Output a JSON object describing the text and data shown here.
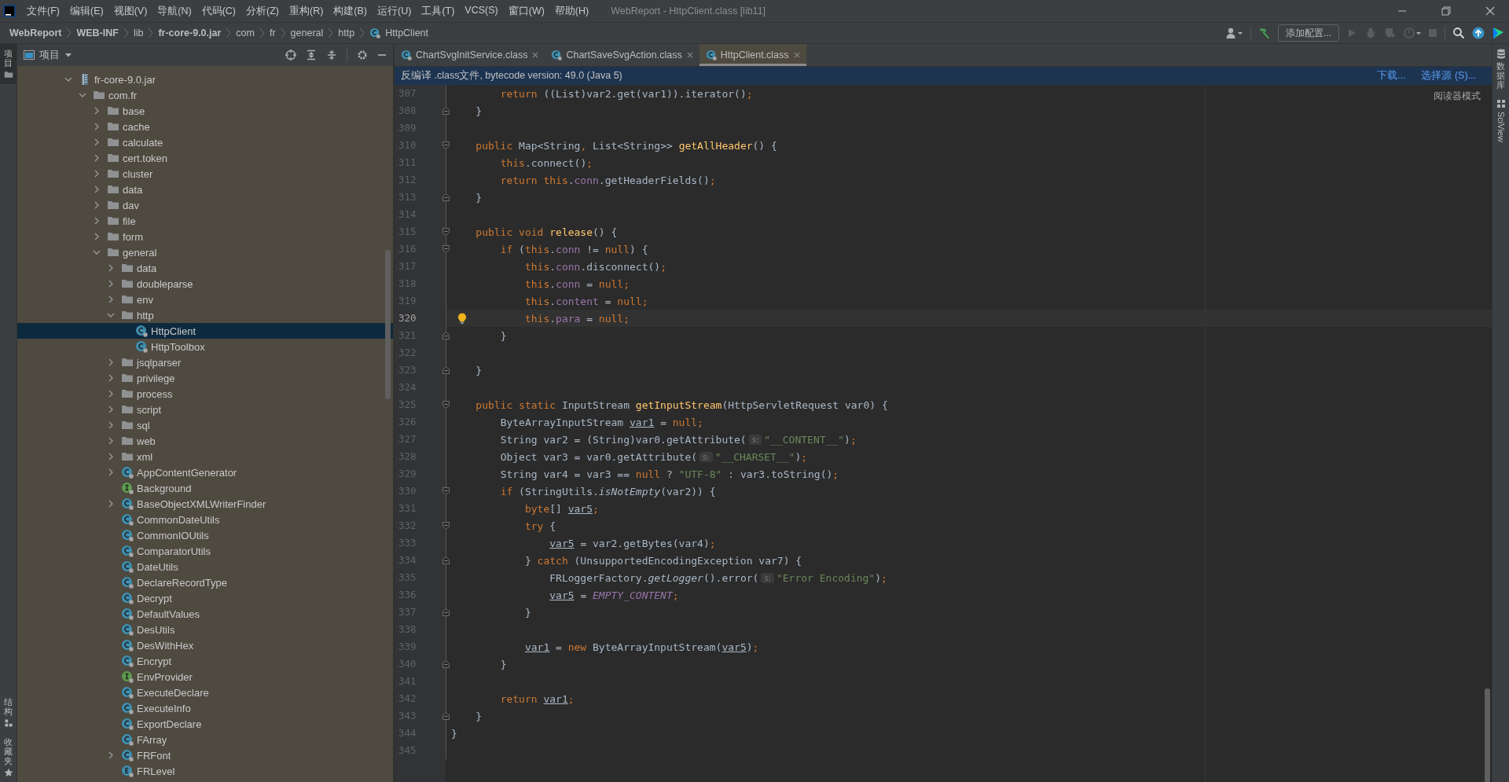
{
  "window": {
    "title": "WebReport - HttpClient.class [lib11]"
  },
  "menu": [
    "文件(F)",
    "编辑(E)",
    "视图(V)",
    "导航(N)",
    "代码(C)",
    "分析(Z)",
    "重构(R)",
    "构建(B)",
    "运行(U)",
    "工具(T)",
    "VCS(S)",
    "窗口(W)",
    "帮助(H)"
  ],
  "breadcrumbs": [
    {
      "label": "WebReport",
      "bold": true,
      "kind": "path"
    },
    {
      "label": "WEB-INF",
      "bold": true,
      "kind": "path"
    },
    {
      "label": "lib",
      "bold": false,
      "kind": "path"
    },
    {
      "label": "fr-core-9.0.jar",
      "bold": true,
      "kind": "path"
    },
    {
      "label": "com",
      "bold": false,
      "kind": "path"
    },
    {
      "label": "fr",
      "bold": false,
      "kind": "path"
    },
    {
      "label": "general",
      "bold": false,
      "kind": "path"
    },
    {
      "label": "http",
      "bold": false,
      "kind": "path"
    },
    {
      "label": "HttpClient",
      "bold": false,
      "kind": "class"
    }
  ],
  "toolbar": {
    "run_config": "添加配置..."
  },
  "left_stripe": {
    "top": [
      {
        "label": "项目",
        "selected": true
      }
    ],
    "bottom": [
      {
        "label": "结构",
        "selected": false
      },
      {
        "label": "收藏夹",
        "selected": false
      }
    ]
  },
  "project": {
    "title": "项目",
    "tree": [
      {
        "label": "fr-core-9.0.jar",
        "kind": "jar",
        "expanded": true,
        "selected": false,
        "children": [
          {
            "label": "com.fr",
            "kind": "folder",
            "expanded": true,
            "selected": false,
            "children": [
              {
                "label": "base",
                "kind": "folder",
                "expanded": false,
                "selected": false
              },
              {
                "label": "cache",
                "kind": "folder",
                "expanded": false,
                "selected": false
              },
              {
                "label": "calculate",
                "kind": "folder",
                "expanded": false,
                "selected": false
              },
              {
                "label": "cert.token",
                "kind": "folder",
                "expanded": false,
                "selected": false
              },
              {
                "label": "cluster",
                "kind": "folder",
                "expanded": false,
                "selected": false
              },
              {
                "label": "data",
                "kind": "folder",
                "expanded": false,
                "selected": false
              },
              {
                "label": "dav",
                "kind": "folder",
                "expanded": false,
                "selected": false
              },
              {
                "label": "file",
                "kind": "folder",
                "expanded": false,
                "selected": false
              },
              {
                "label": "form",
                "kind": "folder",
                "expanded": false,
                "selected": false
              },
              {
                "label": "general",
                "kind": "folder",
                "expanded": true,
                "selected": false,
                "children": [
                  {
                    "label": "data",
                    "kind": "folder",
                    "expanded": false,
                    "selected": false
                  },
                  {
                    "label": "doubleparse",
                    "kind": "folder",
                    "expanded": false,
                    "selected": false
                  },
                  {
                    "label": "env",
                    "kind": "folder",
                    "expanded": false,
                    "selected": false
                  },
                  {
                    "label": "http",
                    "kind": "folder",
                    "expanded": true,
                    "selected": false,
                    "children": [
                      {
                        "label": "HttpClient",
                        "kind": "class",
                        "selected": true
                      },
                      {
                        "label": "HttpToolbox",
                        "kind": "class",
                        "selected": false
                      }
                    ]
                  },
                  {
                    "label": "jsqlparser",
                    "kind": "folder",
                    "expanded": false,
                    "selected": false
                  },
                  {
                    "label": "privilege",
                    "kind": "folder",
                    "expanded": false,
                    "selected": false
                  },
                  {
                    "label": "process",
                    "kind": "folder",
                    "expanded": false,
                    "selected": false
                  },
                  {
                    "label": "script",
                    "kind": "folder",
                    "expanded": false,
                    "selected": false
                  },
                  {
                    "label": "sql",
                    "kind": "folder",
                    "expanded": false,
                    "selected": false
                  },
                  {
                    "label": "web",
                    "kind": "folder",
                    "expanded": false,
                    "selected": false
                  },
                  {
                    "label": "xml",
                    "kind": "folder",
                    "expanded": false,
                    "selected": false
                  },
                  {
                    "label": "AppContentGenerator",
                    "kind": "class",
                    "expanded": false,
                    "selected": false
                  },
                  {
                    "label": "Background",
                    "kind": "interface",
                    "selected": false
                  },
                  {
                    "label": "BaseObjectXMLWriterFinder",
                    "kind": "class",
                    "expanded": false,
                    "selected": false
                  },
                  {
                    "label": "CommonDateUtils",
                    "kind": "class",
                    "selected": false
                  },
                  {
                    "label": "CommonIOUtils",
                    "kind": "class",
                    "selected": false
                  },
                  {
                    "label": "ComparatorUtils",
                    "kind": "class",
                    "selected": false
                  },
                  {
                    "label": "DateUtils",
                    "kind": "class",
                    "selected": false
                  },
                  {
                    "label": "DeclareRecordType",
                    "kind": "class",
                    "selected": false
                  },
                  {
                    "label": "Decrypt",
                    "kind": "class",
                    "selected": false
                  },
                  {
                    "label": "DefaultValues",
                    "kind": "class",
                    "selected": false
                  },
                  {
                    "label": "DesUtils",
                    "kind": "class",
                    "selected": false
                  },
                  {
                    "label": "DesWithHex",
                    "kind": "class",
                    "selected": false
                  },
                  {
                    "label": "Encrypt",
                    "kind": "class",
                    "selected": false
                  },
                  {
                    "label": "EnvProvider",
                    "kind": "interface",
                    "selected": false
                  },
                  {
                    "label": "ExecuteDeclare",
                    "kind": "class",
                    "selected": false
                  },
                  {
                    "label": "ExecuteInfo",
                    "kind": "class",
                    "selected": false
                  },
                  {
                    "label": "ExportDeclare",
                    "kind": "class",
                    "selected": false
                  },
                  {
                    "label": "FArray",
                    "kind": "class",
                    "selected": false
                  },
                  {
                    "label": "FRFont",
                    "kind": "class",
                    "expanded": false,
                    "selected": false
                  },
                  {
                    "label": "FRLevel",
                    "kind": "enum",
                    "selected": false
                  }
                ]
              }
            ]
          }
        ]
      }
    ]
  },
  "editor": {
    "tabs": [
      {
        "label": "ChartSvgInitService.class",
        "selected": false
      },
      {
        "label": "ChartSaveSvgAction.class",
        "selected": false
      },
      {
        "label": "HttpClient.class",
        "selected": true
      }
    ],
    "banner": {
      "text": "反编译 .class文件, bytecode version: 49.0 (Java 5)",
      "links": [
        "下载...",
        "选择源 (S)..."
      ]
    },
    "reader_mode": "阅读器模式",
    "lines": [
      {
        "number": "307",
        "kind": "plain",
        "current": false,
        "tokens": [
          {
            "text": "        return",
            "kind": "keyword"
          },
          {
            "text": " ((List)var2.get(var1)).iterator()",
            "kind": "plain"
          },
          {
            "text": ";",
            "kind": "keyword"
          }
        ]
      },
      {
        "number": "308",
        "kind": "fold-end",
        "current": false,
        "tokens": [
          {
            "text": "    }",
            "kind": "plain"
          }
        ]
      },
      {
        "number": "309",
        "kind": "plain",
        "current": false
      },
      {
        "number": "310",
        "kind": "fold-start",
        "current": false,
        "tokens": [
          {
            "text": "    public",
            "kind": "keyword"
          },
          {
            "text": " Map<String",
            "kind": "plain"
          },
          {
            "text": ",",
            "kind": "keyword"
          },
          {
            "text": " List<String>> ",
            "kind": "plain"
          },
          {
            "text": "getAllHeader",
            "kind": "method"
          },
          {
            "text": "() {",
            "kind": "plain"
          }
        ]
      },
      {
        "number": "311",
        "kind": "plain",
        "current": false,
        "tokens": [
          {
            "text": "        this",
            "kind": "keyword"
          },
          {
            "text": ".connect()",
            "kind": "plain"
          },
          {
            "text": ";",
            "kind": "keyword"
          }
        ]
      },
      {
        "number": "312",
        "kind": "plain",
        "current": false,
        "tokens": [
          {
            "text": "        return this",
            "kind": "keyword"
          },
          {
            "text": ".",
            "kind": "plain"
          },
          {
            "text": "conn",
            "kind": "field"
          },
          {
            "text": ".getHeaderFields()",
            "kind": "plain"
          },
          {
            "text": ";",
            "kind": "keyword"
          }
        ]
      },
      {
        "number": "313",
        "kind": "fold-end",
        "current": false,
        "tokens": [
          {
            "text": "    }",
            "kind": "plain"
          }
        ]
      },
      {
        "number": "314",
        "kind": "plain",
        "current": false
      },
      {
        "number": "315",
        "kind": "fold-start",
        "current": false,
        "tokens": [
          {
            "text": "    public void ",
            "kind": "keyword"
          },
          {
            "text": "release",
            "kind": "method"
          },
          {
            "text": "() {",
            "kind": "plain"
          }
        ]
      },
      {
        "number": "316",
        "kind": "fold-start",
        "current": false,
        "tokens": [
          {
            "text": "        if ",
            "kind": "keyword"
          },
          {
            "text": "(",
            "kind": "plain"
          },
          {
            "text": "this",
            "kind": "keyword"
          },
          {
            "text": ".",
            "kind": "plain"
          },
          {
            "text": "conn",
            "kind": "field"
          },
          {
            "text": " != ",
            "kind": "plain"
          },
          {
            "text": "null",
            "kind": "keyword"
          },
          {
            "text": ") {",
            "kind": "plain"
          }
        ]
      },
      {
        "number": "317",
        "kind": "plain",
        "current": false,
        "tokens": [
          {
            "text": "            this",
            "kind": "keyword"
          },
          {
            "text": ".",
            "kind": "plain"
          },
          {
            "text": "conn",
            "kind": "field"
          },
          {
            "text": ".disconnect()",
            "kind": "plain"
          },
          {
            "text": ";",
            "kind": "keyword"
          }
        ]
      },
      {
        "number": "318",
        "kind": "plain",
        "current": false,
        "tokens": [
          {
            "text": "            this",
            "kind": "keyword"
          },
          {
            "text": ".",
            "kind": "plain"
          },
          {
            "text": "conn",
            "kind": "field"
          },
          {
            "text": " = ",
            "kind": "plain"
          },
          {
            "text": "null;",
            "kind": "keyword"
          }
        ]
      },
      {
        "number": "319",
        "kind": "plain",
        "current": false,
        "tokens": [
          {
            "text": "            this",
            "kind": "keyword"
          },
          {
            "text": ".",
            "kind": "plain"
          },
          {
            "text": "content",
            "kind": "field"
          },
          {
            "text": " = ",
            "kind": "plain"
          },
          {
            "text": "null;",
            "kind": "keyword"
          }
        ]
      },
      {
        "number": "320",
        "kind": "plain",
        "current": true,
        "tokens": [
          {
            "text": "            this",
            "kind": "keyword"
          },
          {
            "text": ".",
            "kind": "plain"
          },
          {
            "text": "para",
            "kind": "field"
          },
          {
            "text": " = ",
            "kind": "plain"
          },
          {
            "text": "null;",
            "kind": "keyword"
          }
        ]
      },
      {
        "number": "321",
        "kind": "fold-end",
        "current": false,
        "tokens": [
          {
            "text": "        }",
            "kind": "plain"
          }
        ]
      },
      {
        "number": "322",
        "kind": "plain",
        "current": false
      },
      {
        "number": "323",
        "kind": "fold-end",
        "current": false,
        "tokens": [
          {
            "text": "    }",
            "kind": "plain"
          }
        ]
      },
      {
        "number": "324",
        "kind": "plain",
        "current": false
      },
      {
        "number": "325",
        "kind": "fold-start",
        "current": false,
        "tokens": [
          {
            "text": "    public static ",
            "kind": "keyword"
          },
          {
            "text": "InputStream ",
            "kind": "plain"
          },
          {
            "text": "getInputStream",
            "kind": "method"
          },
          {
            "text": "(HttpServletRequest var0) {",
            "kind": "plain"
          }
        ]
      },
      {
        "number": "326",
        "kind": "plain",
        "current": false,
        "tokens": [
          {
            "text": "        ByteArrayInputStream ",
            "kind": "plain"
          },
          {
            "text": "var1",
            "kind": "reassigned"
          },
          {
            "text": " = ",
            "kind": "plain"
          },
          {
            "text": "null;",
            "kind": "keyword"
          }
        ]
      },
      {
        "number": "327",
        "kind": "plain",
        "current": false,
        "tokens": [
          {
            "text": "        String var2 = (String)var0.getAttribute(",
            "kind": "plain"
          },
          {
            "text": "s:",
            "kind": "hint"
          },
          {
            "text": "\"__CONTENT__\"",
            "kind": "string"
          },
          {
            "text": ")",
            "kind": "plain"
          },
          {
            "text": ";",
            "kind": "keyword"
          }
        ]
      },
      {
        "number": "328",
        "kind": "plain",
        "current": false,
        "tokens": [
          {
            "text": "        Object var3 = var0.getAttribute(",
            "kind": "plain"
          },
          {
            "text": "s:",
            "kind": "hint"
          },
          {
            "text": "\"__CHARSET__\"",
            "kind": "string"
          },
          {
            "text": ")",
            "kind": "plain"
          },
          {
            "text": ";",
            "kind": "keyword"
          }
        ]
      },
      {
        "number": "329",
        "kind": "plain",
        "current": false,
        "tokens": [
          {
            "text": "        String var4 = var3 == ",
            "kind": "plain"
          },
          {
            "text": "null",
            "kind": "keyword"
          },
          {
            "text": " ? ",
            "kind": "plain"
          },
          {
            "text": "\"UTF-8\"",
            "kind": "string"
          },
          {
            "text": " : var3.toString()",
            "kind": "plain"
          },
          {
            "text": ";",
            "kind": "keyword"
          }
        ]
      },
      {
        "number": "330",
        "kind": "fold-start",
        "current": false,
        "tokens": [
          {
            "text": "        if ",
            "kind": "keyword"
          },
          {
            "text": "(StringUtils.",
            "kind": "plain"
          },
          {
            "text": "isNotEmpty",
            "kind": "italic"
          },
          {
            "text": "(var2)) {",
            "kind": "plain"
          }
        ]
      },
      {
        "number": "331",
        "kind": "plain",
        "current": false,
        "tokens": [
          {
            "text": "            byte",
            "kind": "keyword"
          },
          {
            "text": "[] ",
            "kind": "plain"
          },
          {
            "text": "var5",
            "kind": "reassigned"
          },
          {
            "text": ";",
            "kind": "keyword"
          }
        ]
      },
      {
        "number": "332",
        "kind": "fold-start",
        "current": false,
        "tokens": [
          {
            "text": "            try ",
            "kind": "keyword"
          },
          {
            "text": "{",
            "kind": "plain"
          }
        ]
      },
      {
        "number": "333",
        "kind": "plain",
        "current": false,
        "tokens": [
          {
            "text": "                var5",
            "kind": "reassigned"
          },
          {
            "text": " = var2.getBytes(var4)",
            "kind": "plain"
          },
          {
            "text": ";",
            "kind": "keyword"
          }
        ]
      },
      {
        "number": "334",
        "kind": "fold-end",
        "current": false,
        "tokens": [
          {
            "text": "            } ",
            "kind": "plain"
          },
          {
            "text": "catch ",
            "kind": "keyword"
          },
          {
            "text": "(UnsupportedEncodingException var7) {",
            "kind": "plain"
          }
        ]
      },
      {
        "number": "335",
        "kind": "plain",
        "current": false,
        "tokens": [
          {
            "text": "                FRLoggerFactory.",
            "kind": "plain"
          },
          {
            "text": "getLogger",
            "kind": "italic"
          },
          {
            "text": "().error(",
            "kind": "plain"
          },
          {
            "text": "s:",
            "kind": "hint"
          },
          {
            "text": "\"Error Encoding\"",
            "kind": "string"
          },
          {
            "text": ")",
            "kind": "plain"
          },
          {
            "text": ";",
            "kind": "keyword"
          }
        ]
      },
      {
        "number": "336",
        "kind": "plain",
        "current": false,
        "tokens": [
          {
            "text": "                var5",
            "kind": "reassigned"
          },
          {
            "text": " = ",
            "kind": "plain"
          },
          {
            "text": "EMPTY_CONTENT",
            "kind": "constant"
          },
          {
            "text": ";",
            "kind": "keyword"
          }
        ]
      },
      {
        "number": "337",
        "kind": "fold-end",
        "current": false,
        "tokens": [
          {
            "text": "            }",
            "kind": "plain"
          }
        ]
      },
      {
        "number": "338",
        "kind": "plain",
        "current": false
      },
      {
        "number": "339",
        "kind": "plain",
        "current": false,
        "tokens": [
          {
            "text": "            var1",
            "kind": "reassigned"
          },
          {
            "text": " = ",
            "kind": "plain"
          },
          {
            "text": "new ",
            "kind": "keyword"
          },
          {
            "text": "ByteArrayInputStream(",
            "kind": "plain"
          },
          {
            "text": "var5",
            "kind": "reassigned"
          },
          {
            "text": ")",
            "kind": "plain"
          },
          {
            "text": ";",
            "kind": "keyword"
          }
        ]
      },
      {
        "number": "340",
        "kind": "fold-end",
        "current": false,
        "tokens": [
          {
            "text": "        }",
            "kind": "plain"
          }
        ]
      },
      {
        "number": "341",
        "kind": "plain",
        "current": false
      },
      {
        "number": "342",
        "kind": "plain",
        "current": false,
        "tokens": [
          {
            "text": "        return ",
            "kind": "keyword"
          },
          {
            "text": "var1",
            "kind": "reassigned"
          },
          {
            "text": ";",
            "kind": "keyword"
          }
        ]
      },
      {
        "number": "343",
        "kind": "fold-end",
        "current": false,
        "tokens": [
          {
            "text": "    }",
            "kind": "plain"
          }
        ]
      },
      {
        "number": "344",
        "kind": "plain",
        "current": false,
        "tokens": [
          {
            "text": "}",
            "kind": "plain"
          }
        ]
      },
      {
        "number": "345",
        "kind": "plain",
        "current": false
      }
    ]
  },
  "right_stripe": [
    {
      "label": "数据库",
      "kind": "stacked"
    },
    {
      "label": "SciView",
      "kind": "rotated"
    }
  ]
}
